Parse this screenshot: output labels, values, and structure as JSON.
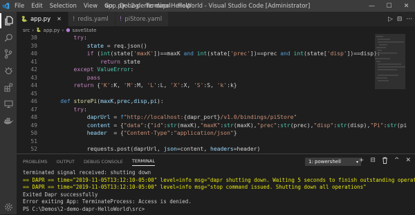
{
  "window": {
    "title": "app.py - 2-demo-dapr-HelloWorld - Visual Studio Code [Administrator]"
  },
  "menu": [
    "File",
    "Edit",
    "Selection",
    "View",
    "Go",
    "Debug",
    "Terminal",
    "Help"
  ],
  "tabs": [
    {
      "label": "app.py",
      "icon": "python-icon",
      "active": true
    },
    {
      "label": "redis.yaml",
      "icon": "yaml-icon",
      "active": false
    },
    {
      "label": "piStore.yaml",
      "icon": "yaml-icon",
      "active": false
    }
  ],
  "breadcrumb": {
    "folder": "src",
    "file": "app.py",
    "symbol": "saveState"
  },
  "code_lines": [
    {
      "n": "38",
      "html": "        <span class='k'>try</span><span class='t'>:</span>"
    },
    {
      "n": "39",
      "html": "            <span class='v'>state</span><span class='t'> = req.json()</span>"
    },
    {
      "n": "40",
      "html": "            <span class='k'>if</span><span class='t'> (</span><span class='c'>int</span><span class='t'>(state[</span><span class='s'>'maxK'</span><span class='t'>])==maxK </span><span class='b'>and</span><span class='t'> </span><span class='c'>int</span><span class='t'>(state[</span><span class='s'>'prec'</span><span class='t'>])==prec </span><span class='b'>and</span><span class='t'> </span><span class='c'>int</span><span class='t'>(state[</span><span class='s'>'disp'</span><span class='t'>])==disp):</span>"
    },
    {
      "n": "41",
      "html": "                <span class='k'>return</span><span class='t'> state</span>"
    },
    {
      "n": "42",
      "html": "        <span class='k'>except</span><span class='t'> </span><span class='c'>ValueError</span><span class='t'>:</span>"
    },
    {
      "n": "43",
      "html": "            <span class='k'>pass</span>"
    },
    {
      "n": "44",
      "html": "        <span class='k'>return</span><span class='t'> {</span><span class='s'>'K'</span><span class='t'>:K, </span><span class='s'>'M'</span><span class='t'>:M, </span><span class='s'>'L'</span><span class='t'>:L, </span><span class='s'>'X'</span><span class='t'>:X, </span><span class='s'>'S'</span><span class='t'>:S, </span><span class='s'>'k'</span><span class='t'>:k}</span>"
    },
    {
      "n": "45",
      "html": ""
    },
    {
      "n": "46",
      "html": "    <span class='b'>def</span><span class='t'> </span><span class='f'>storePi</span><span class='t'>(</span><span class='v'>maxK</span><span class='t'>,</span><span class='v'>prec</span><span class='t'>,</span><span class='v'>disp</span><span class='t'>,</span><span class='v'>pi</span><span class='t'>):</span>"
    },
    {
      "n": "47",
      "html": "        <span class='k'>try</span><span class='t'>:</span>"
    },
    {
      "n": "48",
      "html": "            <span class='v'>daprUrl</span><span class='t'> = </span><span class='b'>f</span><span class='s'>\"http://localhost:</span><span class='t'>{dapr_port}</span><span class='s'>/v1.0/bindings/piStore\"</span>"
    },
    {
      "n": "49",
      "html": "            <span class='v'>content</span><span class='t'> = {</span><span class='s'>\"data\"</span><span class='t'>:{</span><span class='s'>\"id\"</span><span class='t'>:</span><span class='c'>str</span><span class='t'>(maxK),</span><span class='s'>\"maxK\"</span><span class='t'>:</span><span class='c'>str</span><span class='t'>(maxK),</span><span class='s'>\"prec\"</span><span class='t'>:</span><span class='c'>str</span><span class='t'>(prec),</span><span class='s'>\"disp\"</span><span class='t'>:</span><span class='c'>str</span><span class='t'>(disp),</span><span class='s'>\"Pi\"</span><span class='t'>:</span><span class='c'>str</span><span class='t'>(pi)}}</span>"
    },
    {
      "n": "50",
      "html": "            <span class='v'>header</span><span class='t'>  = {</span><span class='s'>\"Content-Type\"</span><span class='t'>:</span><span class='s'>\"application/json\"</span><span class='t'>}</span>"
    },
    {
      "n": "51",
      "html": ""
    },
    {
      "n": "52",
      "html": "            <span class='t'>requests.post(daprUrl, </span><span class='v'>json</span><span class='t'>=content, </span><span class='v'>headers</span><span class='t'>=header)</span>"
    },
    {
      "n": "53",
      "html": "        <span class='k'>except</span><span class='t'> </span><span class='c'>Exception</span><span class='t'> </span><span class='k'>as</span><span class='t'> e:</span>"
    },
    {
      "n": "54",
      "html": "            <span class='f'>print</span><span class='t'>(e, </span><span class='v'>flush</span><span class='t'>=</span><span class='b'>True</span><span class='t'>)</span>"
    },
    {
      "n": "55",
      "html": ""
    },
    {
      "n": "56",
      "html": ""
    }
  ],
  "panel": {
    "tabs": [
      "PROBLEMS",
      "OUTPUT",
      "DEBUG CONSOLE",
      "TERMINAL"
    ],
    "active_tab": "TERMINAL",
    "terminal_select": "1: powershell",
    "actions": [
      "+",
      "⊟",
      "🗑",
      "^",
      "✕"
    ]
  },
  "terminal_lines": [
    {
      "cls": "w",
      "text": "terminated signal received: shutting down"
    },
    {
      "cls": "y",
      "text": "== DAPR == time=\"2019-11-05T13:12:10-05:00\" level=info msg=\"dapr shutting down. Waiting 5 seconds to finish outstanding operatio s\""
    },
    {
      "cls": "y",
      "text": "== DAPR == time=\"2019-11-05T13:12:10-05:00\" level=info msg=\"stop command issued. Shutting down all operations\""
    },
    {
      "cls": "w",
      "text": "Exited Dapr successfully"
    },
    {
      "cls": "w",
      "text": "Error exiting App: TerminateProcess: Access is denied."
    },
    {
      "cls": "w",
      "text": "PS C:\\Demos\\2-demo-dapr-HelloWorld\\src>"
    }
  ],
  "colors": {
    "accent": "#007acc",
    "terminal_yellow": "#e5e510"
  }
}
